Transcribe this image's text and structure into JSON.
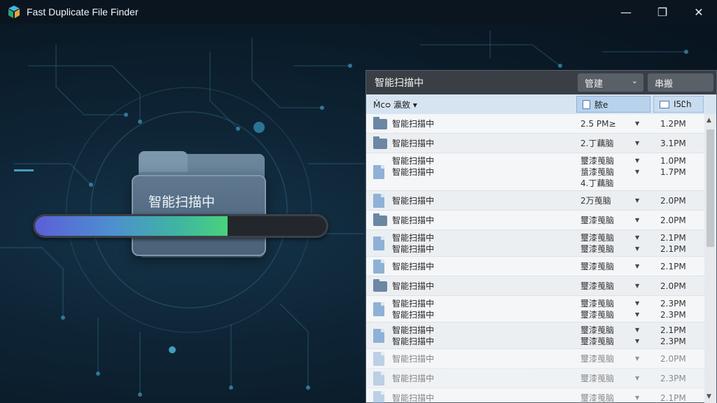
{
  "window": {
    "title": "Fast Duplicate File Finder",
    "minimize": "—",
    "maximize": "❐",
    "close": "✕"
  },
  "scan": {
    "label": "智能扫描中",
    "progress": 0.66
  },
  "panel": {
    "title": "智能扫描中",
    "sort_label": "管建",
    "action_label": "串搬",
    "columns": {
      "name": "Ṁcᴑ 瀛敫 ▾",
      "type": "脓e",
      "time": "I5Ꮭh"
    },
    "rows": [
      {
        "icon": "folder",
        "names": [
          "智能扫描中"
        ],
        "types": [
          "2.5 PM≥"
        ],
        "times": [
          "1.2PM"
        ]
      },
      {
        "icon": "folder",
        "names": [
          "智能扫描中"
        ],
        "types": [
          "2.丁藕脑"
        ],
        "times": [
          "3.1PM"
        ]
      },
      {
        "icon": "file",
        "names": [
          "智能扫描中",
          "智能扫描中"
        ],
        "types": [
          "璽漆䒶脑",
          "螀漆䒶脑",
          "4.丁藕脑"
        ],
        "times": [
          "1.0PM",
          "1.7PM"
        ]
      },
      {
        "icon": "file",
        "names": [
          "智能扫描中"
        ],
        "types": [
          "2万䒶脑"
        ],
        "times": [
          "2.0PM"
        ]
      },
      {
        "icon": "folder",
        "names": [
          "智能扫描中"
        ],
        "types": [
          "璽漆䒶脑"
        ],
        "times": [
          "2.0PM"
        ]
      },
      {
        "icon": "file",
        "names": [
          "智能扫描中",
          "智能扫描中"
        ],
        "types": [
          "璽漆䒶脑",
          "璽漆䒶脑"
        ],
        "times": [
          "2.1PM",
          "2.1PM"
        ]
      },
      {
        "icon": "file",
        "names": [
          "智能扫描中"
        ],
        "types": [
          "璽漆䒶脑"
        ],
        "times": [
          "2.1PM"
        ]
      },
      {
        "icon": "folder",
        "names": [
          "智能扫描中"
        ],
        "types": [
          "璽漆䒶脑"
        ],
        "times": [
          "2.0PM"
        ]
      },
      {
        "icon": "file",
        "names": [
          "智能扫描中",
          "智能扫描中"
        ],
        "types": [
          "璽漆䒶脑",
          "璽漆䒶脑"
        ],
        "times": [
          "2.3PM",
          "2.3PM"
        ]
      },
      {
        "icon": "file",
        "names": [
          "智能扫描中",
          "智能扫描中"
        ],
        "types": [
          "璽漆䒶脑",
          "璽漆䒶脑"
        ],
        "times": [
          "2.1PM",
          "2.3PM"
        ]
      },
      {
        "icon": "file",
        "names": [
          "智能扫描中"
        ],
        "types": [
          "璽漆䒶脑"
        ],
        "times": [
          "2.0PM"
        ]
      },
      {
        "icon": "file",
        "names": [
          "智能扫描中"
        ],
        "types": [
          "璽漆䒶脑"
        ],
        "times": [
          "2.3PM"
        ]
      },
      {
        "icon": "file",
        "names": [
          "智能扫描中"
        ],
        "types": [
          "璽漆䒶脑"
        ],
        "times": [
          "2.1PM"
        ]
      }
    ]
  },
  "colors": {
    "accent": "#49d27c",
    "panel_header": "#3a3f45",
    "column_header": "#d6e4f2"
  }
}
